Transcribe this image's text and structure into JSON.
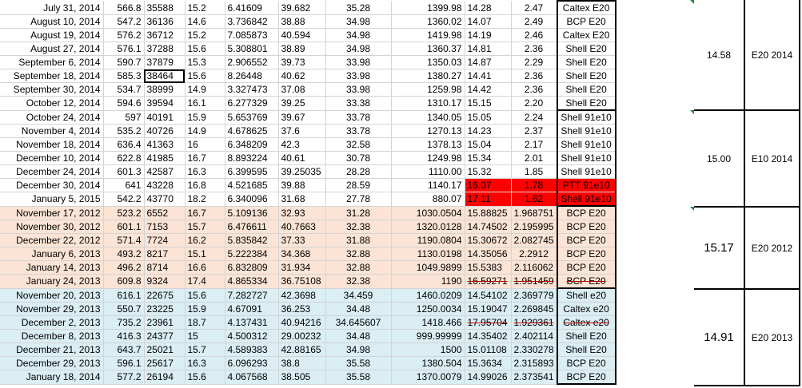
{
  "rows": [
    {
      "date": "July 31, 2014",
      "a": "566.8",
      "b": "35588",
      "c": "15.2",
      "d": "6.41609",
      "e": "39.682",
      "f": "35.28",
      "g": "1399.98",
      "h": "14.28",
      "i": "2.47",
      "station": "Caltex E20"
    },
    {
      "date": "August 10, 2014",
      "a": "547.2",
      "b": "36136",
      "c": "14.6",
      "d": "3.736842",
      "e": "38.88",
      "f": "34.98",
      "g": "1360.02",
      "h": "14.07",
      "i": "2.49",
      "station": "BCP E20"
    },
    {
      "date": "August 19, 2014",
      "a": "576.2",
      "b": "36712",
      "c": "15.2",
      "d": "7.085873",
      "e": "40.594",
      "f": "34.98",
      "g": "1419.98",
      "h": "14.19",
      "i": "2.46",
      "station": "Caltex E20"
    },
    {
      "date": "August 27, 2014",
      "a": "576.1",
      "b": "37288",
      "c": "15.6",
      "d": "5.308801",
      "e": "38.89",
      "f": "34.98",
      "g": "1360.37",
      "h": "14.81",
      "i": "2.36",
      "station": "Shell E20"
    },
    {
      "date": "September 6, 2014",
      "a": "590.7",
      "b": "37879",
      "c": "15.3",
      "d": "2.906552",
      "e": "39.73",
      "f": "33.98",
      "g": "1350.03",
      "h": "14.87",
      "i": "2.29",
      "station": "Shell E20"
    },
    {
      "date": "September 18, 2014",
      "a": "585.3",
      "b": "38464",
      "c": "15.6",
      "d": "8.26448",
      "e": "40.62",
      "f": "33.98",
      "g": "1380.27",
      "h": "14.41",
      "i": "2.36",
      "station": "Shell E20"
    },
    {
      "date": "September 30, 2014",
      "a": "534.7",
      "b": "38999",
      "c": "14.9",
      "d": "3.327473",
      "e": "37.08",
      "f": "33.98",
      "g": "1259.98",
      "h": "14.42",
      "i": "2.36",
      "station": "Shell E20"
    },
    {
      "date": "October 12, 2014",
      "a": "594.6",
      "b": "39594",
      "c": "16.1",
      "d": "6.277329",
      "e": "39.25",
      "f": "33.38",
      "g": "1310.17",
      "h": "15.15",
      "i": "2.20",
      "station": "Shell E20"
    },
    {
      "date": "October 24, 2014",
      "a": "597",
      "b": "40191",
      "c": "15.9",
      "d": "5.653769",
      "e": "39.67",
      "f": "33.78",
      "g": "1340.05",
      "h": "15.05",
      "i": "2.24",
      "station": "Shell 91e10"
    },
    {
      "date": "November 4, 2014",
      "a": "535.2",
      "b": "40726",
      "c": "14.9",
      "d": "4.678625",
      "e": "37.6",
      "f": "33.78",
      "g": "1270.13",
      "h": "14.23",
      "i": "2.37",
      "station": "Shell 91e10"
    },
    {
      "date": "November 18, 2014",
      "a": "636.4",
      "b": "41363",
      "c": "16",
      "d": "6.348209",
      "e": "42.3",
      "f": "32.58",
      "g": "1378.13",
      "h": "15.04",
      "i": "2.17",
      "station": "Shell 91e10"
    },
    {
      "date": "December 10, 2014",
      "a": "622.8",
      "b": "41985",
      "c": "16.7",
      "d": "8.893224",
      "e": "40.61",
      "f": "30.78",
      "g": "1249.98",
      "h": "15.34",
      "i": "2.01",
      "station": "Shell 91e10"
    },
    {
      "date": "December 24, 2014",
      "a": "601.3",
      "b": "42587",
      "c": "16.3",
      "d": "6.399595",
      "e": "39.25035",
      "f": "28.28",
      "g": "1110.00",
      "h": "15.32",
      "i": "1.85",
      "station": "Shell 91e10"
    },
    {
      "date": "December 30, 2014",
      "a": "641",
      "b": "43228",
      "c": "16.8",
      "d": "4.521685",
      "e": "39.88",
      "f": "28.59",
      "g": "1140.17",
      "h": "16.07",
      "i": "1.78",
      "station": "PTT 91e10"
    },
    {
      "date": "January 5, 2015",
      "a": "542.2",
      "b": "43770",
      "c": "18.2",
      "d": "6.340096",
      "e": "31.68",
      "f": "27.78",
      "g": "880.07",
      "h": "17.11",
      "i": "1.62",
      "station": "Shell 91e10"
    },
    {
      "date": "November 17, 2012",
      "a": "523.2",
      "b": "6552",
      "c": "16.7",
      "d": "5.109136",
      "e": "32.93",
      "f": "31.28",
      "g": "1030.0504",
      "h": "15.88825",
      "i": "1.968751",
      "station": "BCP E20"
    },
    {
      "date": "November 30, 2012",
      "a": "601.1",
      "b": "7153",
      "c": "15.7",
      "d": "6.476611",
      "e": "40.7663",
      "f": "32.38",
      "g": "1320.0128",
      "h": "14.74502",
      "i": "2.195995",
      "station": "BCP E20"
    },
    {
      "date": "December 22, 2012",
      "a": "571.4",
      "b": "7724",
      "c": "16.2",
      "d": "5.835842",
      "e": "37.33",
      "f": "31.88",
      "g": "1190.0804",
      "h": "15.30672",
      "i": "2.082745",
      "station": "BCP E20"
    },
    {
      "date": "January 6, 2013",
      "a": "493.2",
      "b": "8217",
      "c": "15.1",
      "d": "5.222384",
      "e": "34.368",
      "f": "32.88",
      "g": "1130.0198",
      "h": "14.35056",
      "i": "2.2912",
      "station": "BCP E20"
    },
    {
      "date": "January 14, 2013",
      "a": "496.2",
      "b": "8714",
      "c": "16.6",
      "d": "6.832809",
      "e": "31.934",
      "f": "32.88",
      "g": "1049.9899",
      "h": "15.5383",
      "i": "2.116062",
      "station": "BCP E20"
    },
    {
      "date": "January 24, 2013",
      "a": "609.8",
      "b": "9324",
      "c": "17.4",
      "d": "4.865334",
      "e": "36.75108",
      "f": "32.38",
      "g": "1190",
      "h": "16.59271",
      "i": "1.951459",
      "station": "BCP E20"
    },
    {
      "date": "November 20, 2013",
      "a": "616.1",
      "b": "22675",
      "c": "15.6",
      "d": "7.282727",
      "e": "42.3698",
      "f": "34.459",
      "g": "1460.0209",
      "h": "14.54102",
      "i": "2.369779",
      "station": "Shell e20"
    },
    {
      "date": "November 29, 2013",
      "a": "550.7",
      "b": "23225",
      "c": "15.9",
      "d": "4.67091",
      "e": "36.253",
      "f": "34.48",
      "g": "1250.0034",
      "h": "15.19047",
      "i": "2.269845",
      "station": "Caltex e20"
    },
    {
      "date": "December 2, 2013",
      "a": "735.2",
      "b": "23961",
      "c": "18.7",
      "d": "4.137431",
      "e": "40.94216",
      "f": "34.645607",
      "g": "1418.466",
      "h": "17.95704",
      "i": "1.929361",
      "station": "Caltex e20"
    },
    {
      "date": "December 8, 2013",
      "a": "416.3",
      "b": "24377",
      "c": "15",
      "d": "4.500312",
      "e": "29.00232",
      "f": "34.48",
      "g": "999.99999",
      "h": "14.35402",
      "i": "2.402114",
      "station": "Shell E20"
    },
    {
      "date": "December 21, 2013",
      "a": "643.7",
      "b": "25021",
      "c": "15.7",
      "d": "4.589383",
      "e": "42.88165",
      "f": "34.98",
      "g": "1500",
      "h": "15.01108",
      "i": "2.330278",
      "station": "Shell E20"
    },
    {
      "date": "December 29, 2013",
      "a": "596.1",
      "b": "25617",
      "c": "16.3",
      "d": "6.096293",
      "e": "38.8",
      "f": "35.58",
      "g": "1380.504",
      "h": "15.3634",
      "i": "2.315893",
      "station": "BCP E20"
    },
    {
      "date": "January 18, 2014",
      "a": "577.2",
      "b": "26194",
      "c": "15.6",
      "d": "4.067568",
      "e": "38.505",
      "f": "35.58",
      "g": "1370.0079",
      "h": "14.99026",
      "i": "2.373541",
      "station": "BCP E20"
    }
  ],
  "summary": [
    {
      "avg": "14.58",
      "label": "E20 2014"
    },
    {
      "avg": "15.00",
      "label": "E10 2014"
    },
    {
      "avg": "15.17",
      "label": "E20 2012"
    },
    {
      "avg": "14.91",
      "label": "E20 2013"
    }
  ],
  "colors": {
    "peach": "#fbe4d5",
    "blue": "#daeef3",
    "highlight": "#ff0000",
    "strike": "#c00000"
  }
}
